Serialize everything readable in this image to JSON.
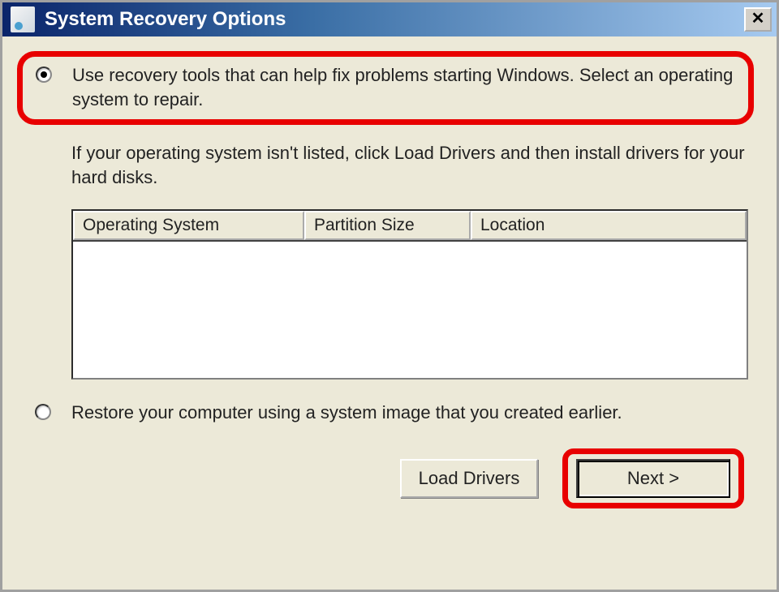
{
  "window": {
    "title": "System Recovery Options",
    "close_label": "✕"
  },
  "options": {
    "option1": {
      "text": "Use recovery tools that can help fix problems starting Windows. Select an operating system to repair.",
      "selected": true
    },
    "hint": "If your operating system isn't listed, click Load Drivers and then install drivers for your hard disks.",
    "option2": {
      "text": "Restore your computer using a system image that you created earlier.",
      "selected": false
    }
  },
  "table": {
    "headers": {
      "os": "Operating System",
      "partition": "Partition Size",
      "location": "Location"
    },
    "rows": []
  },
  "buttons": {
    "load_drivers": "Load Drivers",
    "next": "Next >"
  },
  "annotations": {
    "highlight_color": "#e80000"
  }
}
